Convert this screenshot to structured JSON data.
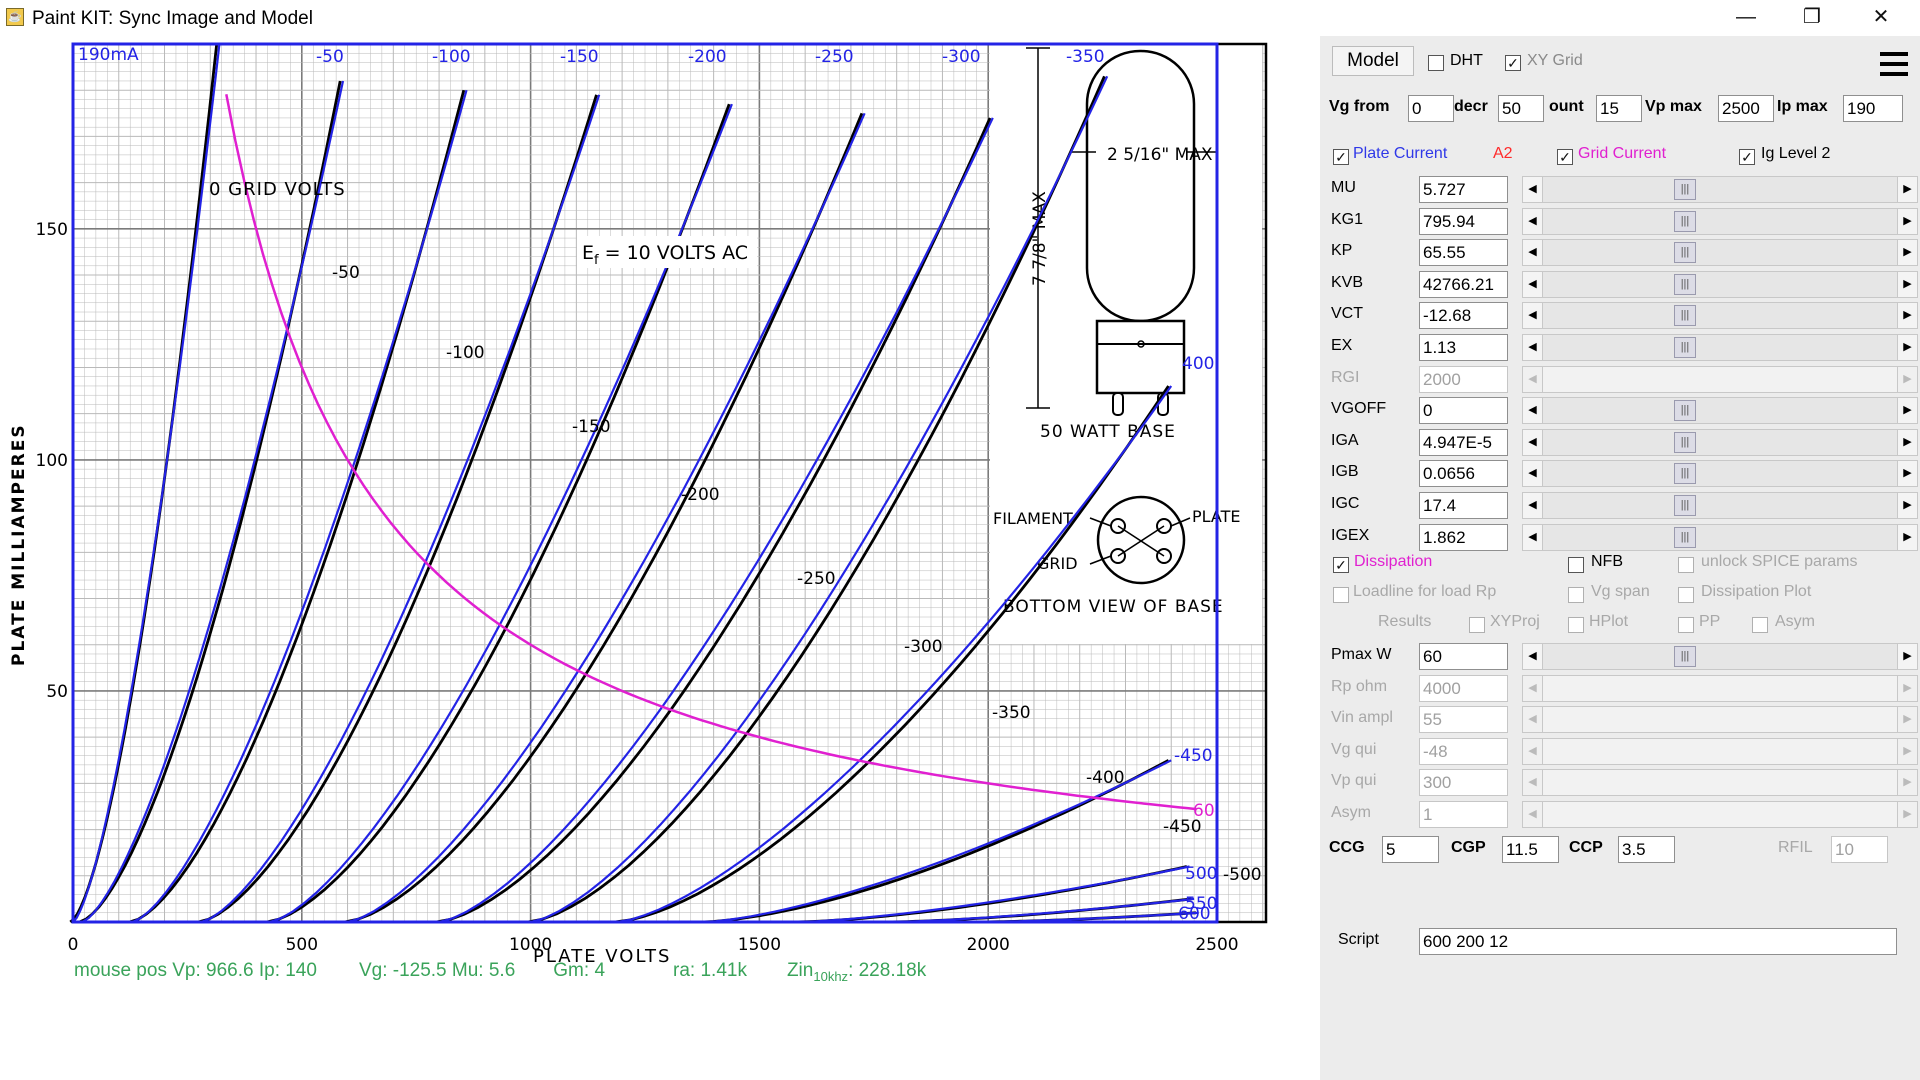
{
  "window": {
    "title": "Paint KIT: Sync Image and Model",
    "app_icon": "java-cup-icon",
    "controls": {
      "minimize": "—",
      "maximize": "❐",
      "close": "✕"
    }
  },
  "plot": {
    "datasheet_labels": {
      "grid_volts": "0  GRID  VOLTS",
      "filament_note": "E",
      "filament_sub": "f",
      "filament_rest": " = 10  VOLTS  AC",
      "y_axis_title": "PLATE  MILLIAMPERES",
      "x_axis_title": "PLATE   VOLTS",
      "base_title": "50  WATT  BASE",
      "bottom_view": "BOTTOM  VIEW  OF  BASE",
      "pin_filament": "FILAMENT",
      "pin_plate": "PLATE",
      "pin_grid": "GRID",
      "dim_max_diam": "2 5/16\" MAX",
      "dim_max_len": "7 7/8\" MAX",
      "y_ticks": [
        "150",
        "100",
        "50"
      ],
      "x_ticks": [
        "0",
        "500",
        "1000",
        "1500",
        "2000",
        "2500"
      ],
      "curve_labels": [
        "-50",
        "-100",
        "-150",
        "-200",
        "-250",
        "-300",
        "-350",
        "-400",
        "-450",
        "-500"
      ]
    },
    "overlay_labels": {
      "top_current": "190mA",
      "top_grid": [
        "-50",
        "-100",
        "-150",
        "-200",
        "-250",
        "-300",
        "-350"
      ],
      "right_side": [
        "400",
        "-450",
        "60",
        "500",
        "550",
        "-600"
      ]
    },
    "chart_data": {
      "type": "line",
      "xlabel": "PLATE   VOLTS",
      "ylabel": "PLATE  MILLIAMPERES",
      "xlim": [
        0,
        2500
      ],
      "ylim": [
        0,
        190
      ],
      "x_ticks": [
        0,
        500,
        1000,
        1500,
        2000,
        2500
      ],
      "y_ticks": [
        50,
        100,
        150
      ],
      "grid": true,
      "series": [
        {
          "vg": 0,
          "start_vp": 0,
          "end_vp": 320,
          "end_ip": 190
        },
        {
          "vg": -50,
          "start_vp": 20,
          "end_vp": 590,
          "end_ip": 182
        },
        {
          "vg": -100,
          "start_vp": 130,
          "end_vp": 860,
          "end_ip": 180
        },
        {
          "vg": -150,
          "start_vp": 280,
          "end_vp": 1150,
          "end_ip": 179
        },
        {
          "vg": -200,
          "start_vp": 430,
          "end_vp": 1440,
          "end_ip": 177
        },
        {
          "vg": -250,
          "start_vp": 600,
          "end_vp": 1730,
          "end_ip": 175
        },
        {
          "vg": -300,
          "start_vp": 800,
          "end_vp": 2010,
          "end_ip": 174
        },
        {
          "vg": -350,
          "start_vp": 1000,
          "end_vp": 2260,
          "end_ip": 183
        },
        {
          "vg": -400,
          "start_vp": 1190,
          "end_vp": 2400,
          "end_ip": 116
        },
        {
          "vg": -450,
          "start_vp": 1380,
          "end_vp": 2400,
          "end_ip": 35
        },
        {
          "vg": -500,
          "start_vp": 1580,
          "end_vp": 2440,
          "end_ip": 12
        },
        {
          "vg": -550,
          "start_vp": 1780,
          "end_vp": 2450,
          "end_ip": 5
        },
        {
          "vg": -600,
          "start_vp": 1980,
          "end_vp": 2460,
          "end_ip": 2
        }
      ],
      "dissipation_curve": {
        "pmax_w": 60,
        "from_vp": 315,
        "to_vp": 2460
      },
      "colors": {
        "model": "#2323e6",
        "image": "#000000",
        "dissipation": "#e020d0",
        "grid_major": "#7b7b7b",
        "grid_minor": "#b9b9b9"
      }
    },
    "status": {
      "mouse": "mouse pos Vp: 966.6  Ip: 140",
      "vg": "Vg: -125.5  Mu: 5.6",
      "gm": "Gm: 4",
      "ra": "ra: 1.41k",
      "zin": "Zin",
      "zin_sub": "10khz",
      "zin_val": ": 228.18k"
    }
  },
  "panel": {
    "model_button": "Model",
    "dht": {
      "label": "DHT",
      "checked": false
    },
    "xy_grid": {
      "label": "XY Grid",
      "checked": true
    },
    "menu_icon": "hamburger-menu-icon",
    "range": {
      "vg_from": {
        "label": "Vg from",
        "value": "0"
      },
      "decr": {
        "label": "decr",
        "value": "50"
      },
      "count": {
        "label": "ount",
        "value": "15"
      },
      "vp_max": {
        "label": "Vp max",
        "value": "2500"
      },
      "ip_max": {
        "label": "Ip max",
        "value": "190"
      }
    },
    "plate_current": {
      "label": "Plate Current",
      "checked": true
    },
    "a2": "A2",
    "grid_current": {
      "label": "Grid Current",
      "checked": true
    },
    "ig_level2": {
      "label": "Ig Level 2",
      "checked": true
    },
    "params": [
      {
        "name": "MU",
        "value": "5.727",
        "enabled": true
      },
      {
        "name": "KG1",
        "value": "795.94",
        "enabled": true
      },
      {
        "name": "KP",
        "value": "65.55",
        "enabled": true
      },
      {
        "name": "KVB",
        "value": "42766.21",
        "enabled": true
      },
      {
        "name": "VCT",
        "value": "-12.68",
        "enabled": true
      },
      {
        "name": "EX",
        "value": "1.13",
        "enabled": true
      },
      {
        "name": "RGI",
        "value": "2000",
        "enabled": false
      },
      {
        "name": "VGOFF",
        "value": "0",
        "enabled": true
      },
      {
        "name": "IGA",
        "value": "4.947E-5",
        "enabled": true
      },
      {
        "name": "IGB",
        "value": "0.0656",
        "enabled": true
      },
      {
        "name": "IGC",
        "value": "17.4",
        "enabled": true
      },
      {
        "name": "IGEX",
        "value": "1.862",
        "enabled": true
      }
    ],
    "dissipation": {
      "label": "Dissipation",
      "checked": true
    },
    "nfb": {
      "label": "NFB",
      "checked": false
    },
    "unlock_spice": {
      "label": "unlock SPICE params",
      "checked": false
    },
    "loadline": {
      "label": "Loadline for load Rp",
      "checked": false
    },
    "vg_span": {
      "label": "Vg span",
      "checked": false
    },
    "dissipation_plot": {
      "label": "Dissipation Plot",
      "checked": false
    },
    "results": "Results",
    "xyproj": {
      "label": "XYProj",
      "checked": false
    },
    "hplot": {
      "label": "HPlot",
      "checked": false
    },
    "pp": {
      "label": "PP",
      "checked": false
    },
    "asym_cb": {
      "label": "Asym",
      "checked": false
    },
    "load_params": [
      {
        "name": "Pmax W",
        "value": "60",
        "enabled": true
      },
      {
        "name": "Rp ohm",
        "value": "4000",
        "enabled": false
      },
      {
        "name": "Vin ampl",
        "value": "55",
        "enabled": false
      },
      {
        "name": "Vg qui",
        "value": "-48",
        "enabled": false
      },
      {
        "name": "Vp qui",
        "value": "300",
        "enabled": false
      },
      {
        "name": "Asym",
        "value": "1",
        "enabled": false
      }
    ],
    "caps": {
      "ccg": {
        "label": "CCG",
        "value": "5"
      },
      "cgp": {
        "label": "CGP",
        "value": "11.5"
      },
      "ccp": {
        "label": "CCP",
        "value": "3.5"
      },
      "rfil": {
        "label": "RFIL",
        "value": "10"
      }
    },
    "script": {
      "label": "Script",
      "value": "600 200 12"
    }
  }
}
